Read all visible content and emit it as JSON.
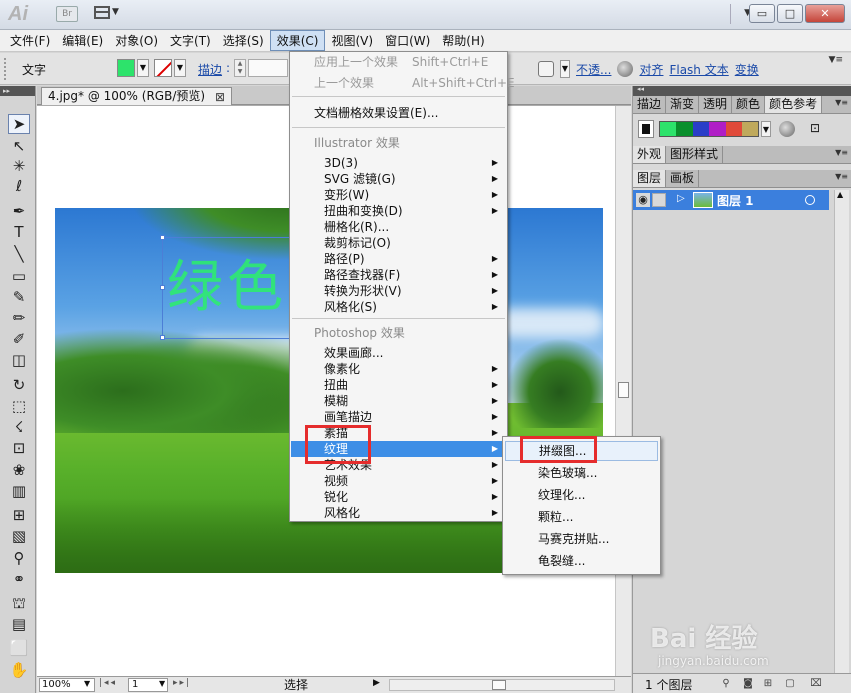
{
  "titlebar": {
    "logo": "Ai",
    "bridge_label": "Br",
    "minimize": "▭",
    "maximize": "□",
    "close": "✕"
  },
  "menubar": [
    "文件(F)",
    "编辑(E)",
    "对象(O)",
    "文字(T)",
    "选择(S)",
    "效果(C)",
    "视图(V)",
    "窗口(W)",
    "帮助(H)"
  ],
  "controlbar": {
    "tool_label": "文字",
    "fill_color": "#2de36b",
    "stroke_label": "描边",
    "stroke_colon": ":",
    "opacity_label": "不透...",
    "align_label": "对齐",
    "flash_text_label": "Flash 文本",
    "transform_label": "变换"
  },
  "toolbar_tools": [
    "selection-tool",
    "direct-selection-tool",
    "magic-wand-tool",
    "lasso-tool",
    "pen-tool",
    "type-tool",
    "line-tool",
    "rectangle-tool",
    "paintbrush-tool",
    "pencil-tool",
    "blob-brush-tool",
    "eraser-tool",
    "rotate-tool",
    "scale-tool",
    "warp-tool",
    "free-transform-tool",
    "symbol-sprayer-tool",
    "graph-tool",
    "mesh-tool",
    "gradient-tool",
    "eyedropper-tool",
    "blend-tool",
    "live-paint-tool",
    "slice-tool",
    "artboard-tool",
    "hand-tool"
  ],
  "document": {
    "tab_title": "4.jpg* @ 100% (RGB/预览)",
    "tab_close": "⊠",
    "canvas_text": "绿色",
    "status": {
      "zoom": "100%",
      "page": "1",
      "selection_label": "选择"
    }
  },
  "panels": {
    "top_tabs": [
      "描边",
      "渐变",
      "透明",
      "颜色",
      "颜色参考"
    ],
    "swatches": [
      "#2de36b",
      "#0a8f2c",
      "#2a3ec8",
      "#b01ec6",
      "#e04a3a",
      "#bfa95c"
    ],
    "appearance_tabs": [
      "外观",
      "图形样式"
    ],
    "layers_tabs": [
      "图层",
      "画板"
    ],
    "layer_name": "图层 1",
    "layers_count": "1 个图层"
  },
  "effects_menu": {
    "apply_last": {
      "label": "应用上一个效果",
      "shortcut": "Shift+Ctrl+E"
    },
    "last_effect": {
      "label": "上一个效果",
      "shortcut": "Alt+Shift+Ctrl+E"
    },
    "doc_raster": "文档栅格效果设置(E)...",
    "illustrator_header": "Illustrator 效果",
    "illustrator_items": [
      "3D(3)",
      "SVG 滤镜(G)",
      "变形(W)",
      "扭曲和变换(D)",
      "栅格化(R)...",
      "裁剪标记(O)",
      "路径(P)",
      "路径查找器(F)",
      "转换为形状(V)",
      "风格化(S)"
    ],
    "photoshop_header": "Photoshop 效果",
    "photoshop_items": [
      "效果画廊...",
      "像素化",
      "扭曲",
      "模糊",
      "画笔描边",
      "素描",
      "纹理",
      "艺术效果",
      "视频",
      "锐化",
      "风格化"
    ]
  },
  "texture_submenu": [
    "拼缀图...",
    "染色玻璃...",
    "纹理化...",
    "颗粒...",
    "马赛克拼贴...",
    "龟裂缝..."
  ],
  "watermark": {
    "logo": "Bai 经验",
    "url": "jingyan.baidu.com"
  }
}
